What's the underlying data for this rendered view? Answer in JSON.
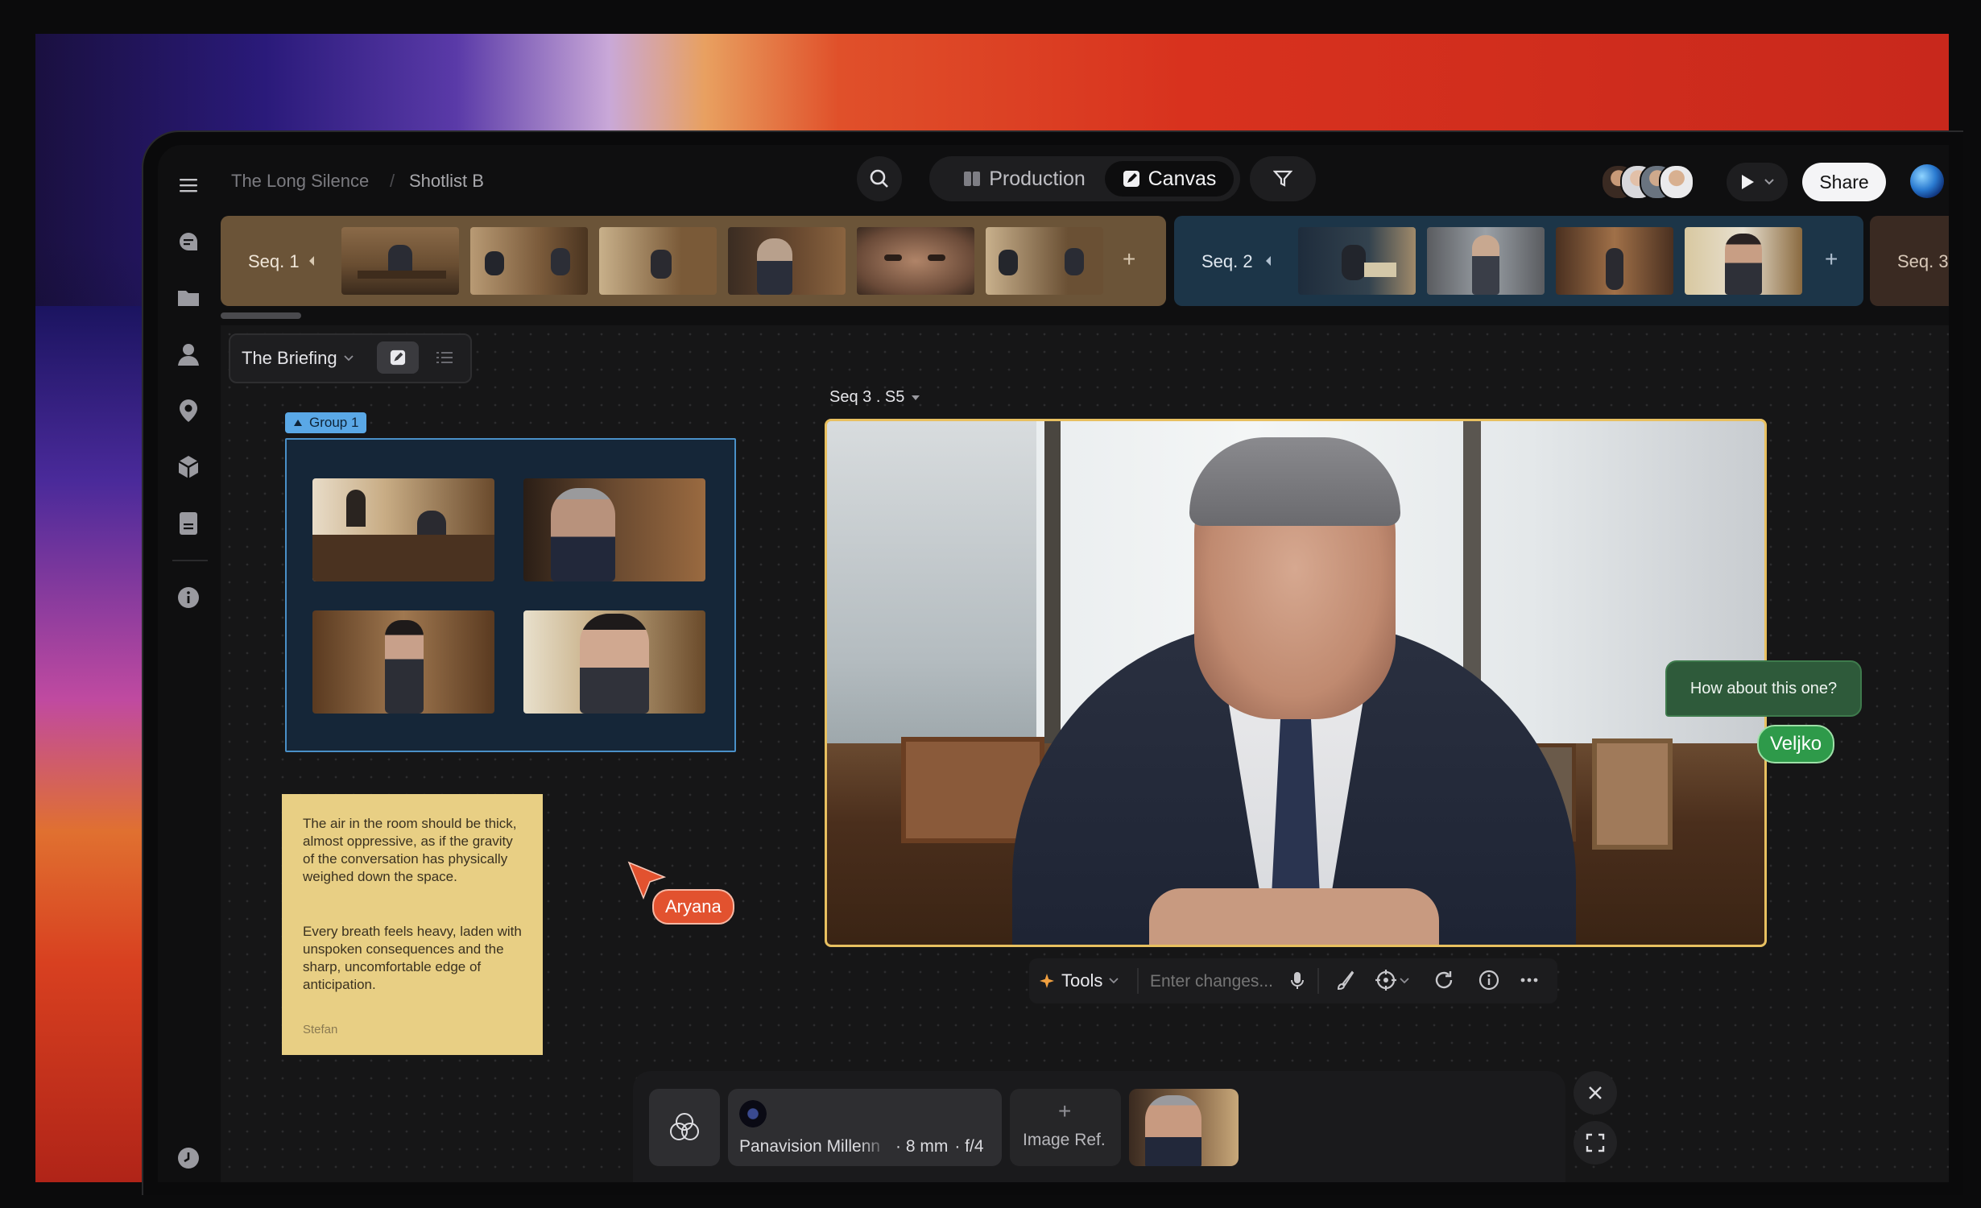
{
  "header": {
    "project": "The Long Silence",
    "separator": "/",
    "page": "Shotlist B",
    "tabs": [
      {
        "label": "Production",
        "active": false
      },
      {
        "label": "Canvas",
        "active": true
      }
    ],
    "share_label": "Share"
  },
  "sequences": [
    {
      "label": "Seq. 1",
      "add": "+",
      "color": "#6b5438"
    },
    {
      "label": "Seq. 2",
      "add": "+",
      "color": "#1c3548"
    },
    {
      "label": "Seq. 3",
      "color": "#3a2a22"
    }
  ],
  "board": {
    "scene_label": "The Briefing",
    "group_label": "Group 1",
    "shot_label": "Seq 3 . S5"
  },
  "sticky": {
    "para1": "The air in the room should be thick, almost oppressive, as if the gravity of the conversation has physically weighed down the space.",
    "para2": "Every breath feels heavy, laden with unspoken consequences and the sharp, uncomfortable edge of anticipation.",
    "author": "Stefan"
  },
  "collab": {
    "cursor_aryana": "Aryana",
    "cursor_veljko": "Veljko",
    "comment": "How about this one?",
    "aryana_color": "#e2522f",
    "veljko_color": "#2e9a4a"
  },
  "toolbar": {
    "tools_label": "Tools",
    "input_placeholder": "Enter changes..."
  },
  "camera": {
    "lens_name": "Panavision Millenn",
    "focal": "· 8 mm",
    "aperture": "· f/4",
    "image_ref_label": "Image Ref.",
    "add": "+"
  },
  "icons": {
    "menu": "menu-icon",
    "chat": "chat-icon",
    "folder": "folder-icon",
    "person": "person-icon",
    "pin": "location-pin-icon",
    "cube": "cube-icon",
    "document": "document-icon",
    "info": "info-icon",
    "history": "clock-icon"
  }
}
